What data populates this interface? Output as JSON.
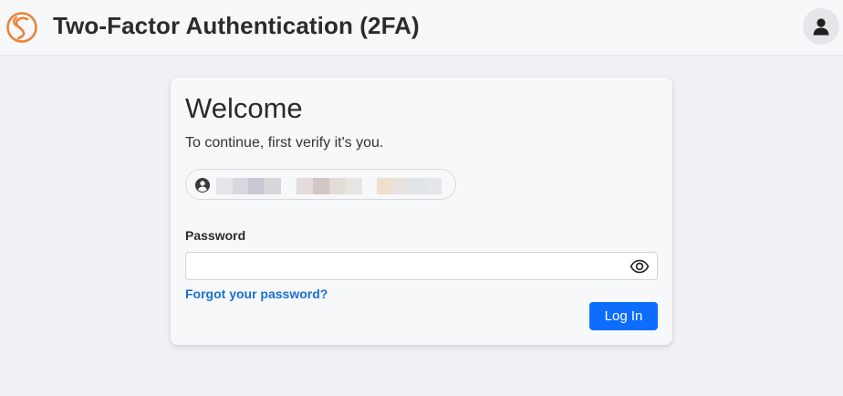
{
  "header": {
    "title": "Two-Factor Authentication (2FA)",
    "logo_icon": "swirl-logo-icon",
    "avatar_icon": "person-icon",
    "brand_color": "#e8833a"
  },
  "card": {
    "heading": "Welcome",
    "subtitle": "To continue, first verify it's you.",
    "account": {
      "icon": "user-circle-icon",
      "redacted": true
    },
    "password": {
      "label": "Password",
      "value": "",
      "placeholder": "",
      "toggle_icon": "eye-icon"
    },
    "forgot_link": "Forgot your password?",
    "login_button": "Log In",
    "accent_color": "#0d6efd"
  }
}
